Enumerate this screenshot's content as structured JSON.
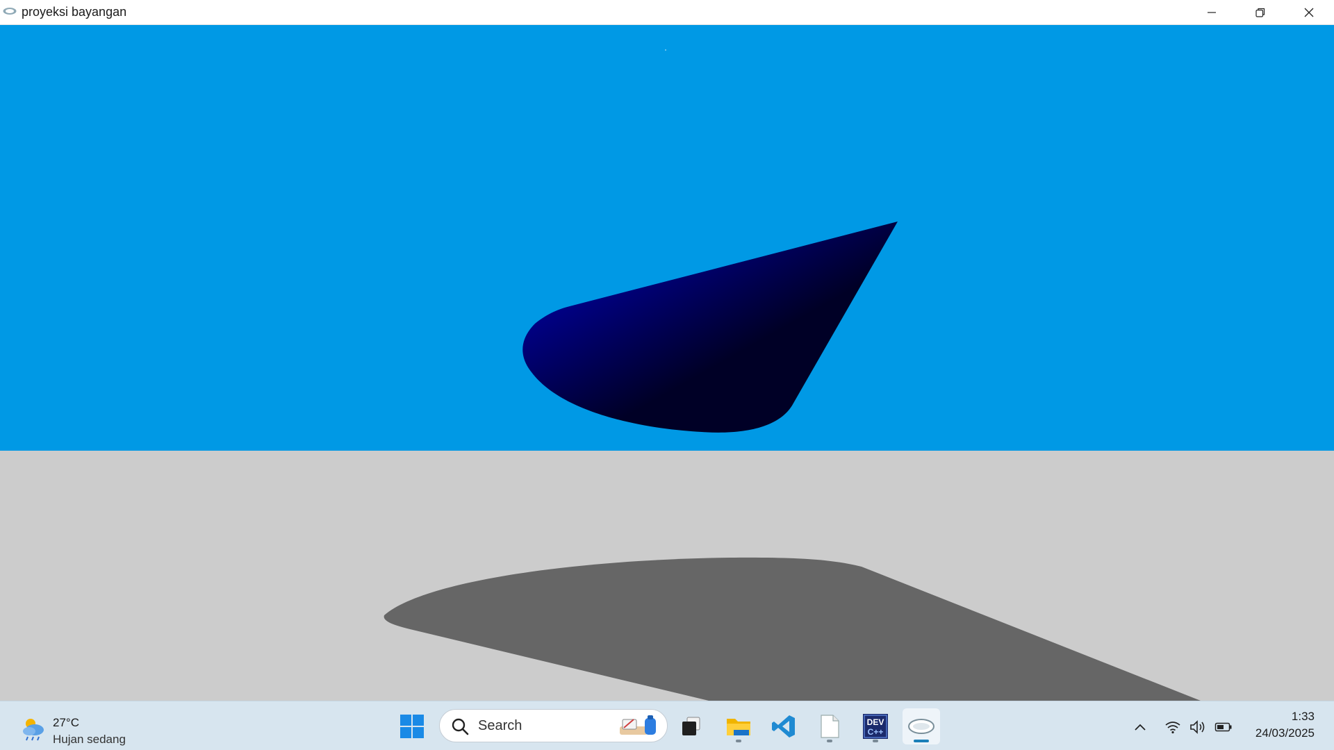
{
  "window": {
    "title": "proyeksi bayangan",
    "controls": [
      "minimize",
      "restore",
      "close"
    ]
  },
  "scene": {
    "sky_color": "#0099e5",
    "floor_color": "#cccccc",
    "shadow_color": "#666666",
    "cone_dark": "#000026",
    "cone_light": "#0000c8"
  },
  "taskbar": {
    "weather": {
      "temperature": "27°C",
      "condition": "Hujan sedang",
      "icon": "cloud-rain-sun-icon"
    },
    "search": {
      "placeholder": "Search"
    },
    "pinned": [
      {
        "name": "start-icon",
        "running": false
      },
      {
        "name": "task-view-icon",
        "running": false
      },
      {
        "name": "file-explorer-icon",
        "running": true
      },
      {
        "name": "vscode-icon",
        "running": false
      },
      {
        "name": "notepad-icon",
        "running": true
      },
      {
        "name": "devcpp-icon",
        "running": true,
        "text": "DEV"
      },
      {
        "name": "opengl-app-icon",
        "running": true,
        "active": true
      }
    ],
    "tray": {
      "icons": [
        "chevron-up-icon",
        "wifi-icon",
        "volume-icon",
        "battery-icon"
      ],
      "time": "1:33",
      "date": "24/03/2025"
    }
  }
}
